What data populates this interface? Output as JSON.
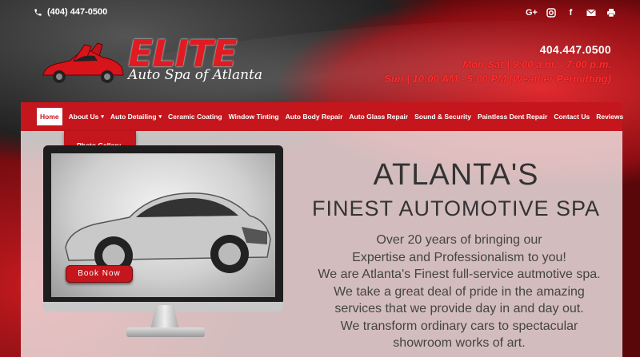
{
  "topbar": {
    "phone": "(404) 447-0500",
    "social_icons": [
      "google-plus-icon",
      "instagram-icon",
      "facebook-icon",
      "email-icon",
      "print-icon"
    ]
  },
  "logo": {
    "title": "ELITE",
    "subtitle": "Auto Spa of Atlanta"
  },
  "contact": {
    "phone": "404.447.0500",
    "hours_weekday": "Mon-Sat | 9:00 a.m. - 7:00 p.m.",
    "hours_sunday": "Sun | 10:00 AM - 5:00 PM (Weather Permitting)"
  },
  "nav": {
    "items": [
      {
        "label": "Home",
        "active": true
      },
      {
        "label": "About Us",
        "has_dropdown": true
      },
      {
        "label": "Auto Detailing",
        "has_dropdown": true
      },
      {
        "label": "Ceramic Coating"
      },
      {
        "label": "Window Tinting"
      },
      {
        "label": "Auto Body Repair"
      },
      {
        "label": "Auto Glass Repair"
      },
      {
        "label": "Sound & Security"
      },
      {
        "label": "Paintless Dent Repair"
      },
      {
        "label": "Contact Us"
      },
      {
        "label": "Reviews"
      }
    ],
    "dropdown_item": "Photo Gallery"
  },
  "hero": {
    "book_button": "Book Now",
    "heading_1": "ATLANTA'S",
    "heading_2": "FINEST AUTOMOTIVE SPA",
    "body_lines": [
      "Over 20 years of bringing our",
      "Expertise and Professionalism to you!",
      "We are Atlanta's Finest full-service autmotive spa.",
      "We take a great deal of pride in the amazing",
      "services that we provide day in and day out.",
      "We transform ordinary cars to spectacular",
      "showroom works of art."
    ]
  },
  "colors": {
    "brand_red": "#c4161c",
    "hours_red": "#ff2d2d"
  }
}
